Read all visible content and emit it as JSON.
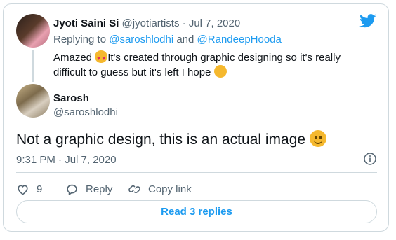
{
  "tweet_parent": {
    "name": "Jyoti Saini Si",
    "handle": "@jyotiartists",
    "separator": "·",
    "date": "Jul 7, 2020",
    "replying_prefix": "Replying to ",
    "mention1": "@saroshlodhi",
    "and": " and ",
    "mention2": "@RandeepHooda",
    "text_part1": "Amazed ",
    "text_part2": "It's created through graphic designing so it's really difficult to guess but it's left I hope "
  },
  "tweet_main": {
    "name": "Sarosh",
    "handle": "@saroshlodhi",
    "text": "Not a graphic design, this is an actual image ",
    "timestamp": "9:31 PM · Jul 7, 2020"
  },
  "actions": {
    "like_count": "9",
    "reply_label": "Reply",
    "copy_label": "Copy link"
  },
  "read_replies_label": "Read 3 replies",
  "colors": {
    "accent": "#1d9bf0",
    "muted": "#536471",
    "border": "#cfd9de"
  }
}
